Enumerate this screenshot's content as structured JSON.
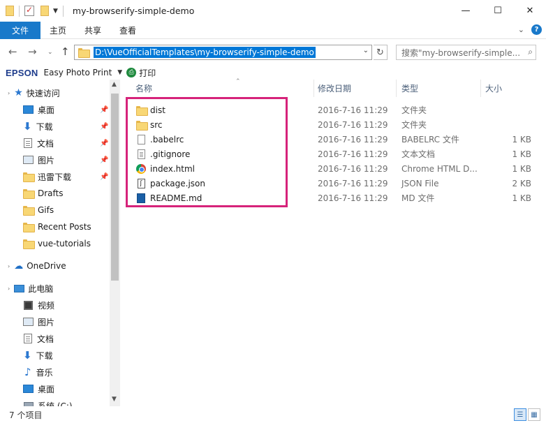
{
  "window": {
    "title": "my-browserify-simple-demo"
  },
  "window_buttons": {
    "minimize": "—",
    "maximize": "☐",
    "close": "✕"
  },
  "ribbon": {
    "tabs": [
      "文件",
      "主页",
      "共享",
      "查看"
    ]
  },
  "address": {
    "path": "D:\\VueOfficialTemplates\\my-browserify-simple-demo"
  },
  "search": {
    "placeholder": "搜索\"my-browserify-simple..."
  },
  "epson": {
    "logo": "EPSON",
    "app": "Easy Photo Print",
    "print": "打印"
  },
  "nav": {
    "quick_access": "快速访问",
    "quick_items": [
      {
        "label": "桌面",
        "icon": "desktop-icon",
        "pinned": true
      },
      {
        "label": "下载",
        "icon": "download-icon",
        "pinned": true
      },
      {
        "label": "文档",
        "icon": "document-icon",
        "pinned": true
      },
      {
        "label": "图片",
        "icon": "picture-icon",
        "pinned": true
      },
      {
        "label": "迅雷下载",
        "icon": "folder-icon",
        "pinned": true
      },
      {
        "label": "Drafts",
        "icon": "folder-icon",
        "pinned": false
      },
      {
        "label": "Gifs",
        "icon": "folder-icon",
        "pinned": false
      },
      {
        "label": "Recent Posts",
        "icon": "folder-icon",
        "pinned": false
      },
      {
        "label": "vue-tutorials",
        "icon": "folder-icon",
        "pinned": false
      }
    ],
    "onedrive": "OneDrive",
    "this_pc": "此电脑",
    "pc_items": [
      {
        "label": "视频",
        "icon": "video-icon"
      },
      {
        "label": "图片",
        "icon": "picture-icon"
      },
      {
        "label": "文档",
        "icon": "document-icon"
      },
      {
        "label": "下载",
        "icon": "download-icon"
      },
      {
        "label": "音乐",
        "icon": "music-icon"
      },
      {
        "label": "桌面",
        "icon": "desktop-icon"
      },
      {
        "label": "系统 (C:)",
        "icon": "disk-icon"
      }
    ]
  },
  "columns": {
    "name": "名称",
    "date": "修改日期",
    "type": "类型",
    "size": "大小"
  },
  "files": [
    {
      "name": "dist",
      "date": "2016-7-16 11:29",
      "type": "文件夹",
      "size": "",
      "icon": "folder-icon"
    },
    {
      "name": "src",
      "date": "2016-7-16 11:29",
      "type": "文件夹",
      "size": "",
      "icon": "folder-icon"
    },
    {
      "name": ".babelrc",
      "date": "2016-7-16 11:29",
      "type": "BABELRC 文件",
      "size": "1 KB",
      "icon": "file-icon"
    },
    {
      "name": ".gitignore",
      "date": "2016-7-16 11:29",
      "type": "文本文档",
      "size": "1 KB",
      "icon": "text-file-icon"
    },
    {
      "name": "index.html",
      "date": "2016-7-16 11:29",
      "type": "Chrome HTML D...",
      "size": "1 KB",
      "icon": "chrome-icon"
    },
    {
      "name": "package.json",
      "date": "2016-7-16 11:29",
      "type": "JSON File",
      "size": "2 KB",
      "icon": "json-file-icon"
    },
    {
      "name": "README.md",
      "date": "2016-7-16 11:29",
      "type": "MD 文件",
      "size": "1 KB",
      "icon": "markdown-file-icon"
    }
  ],
  "status": {
    "count": "7 个项目"
  },
  "colors": {
    "accent": "#1979ca",
    "selection": "#0078d7",
    "highlight_box": "#d6237a"
  }
}
